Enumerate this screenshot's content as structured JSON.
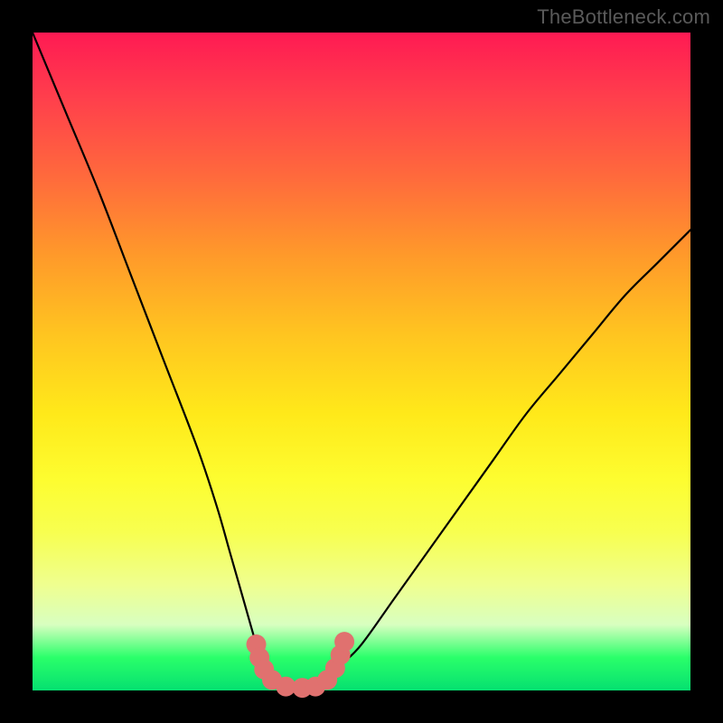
{
  "watermark": "TheBottleneck.com",
  "colors": {
    "background": "#000000",
    "curve_stroke": "#000000",
    "marker_fill": "#e0716f",
    "gradient_top": "#ff1a53",
    "gradient_bottom": "#05e070"
  },
  "chart_data": {
    "type": "line",
    "title": "",
    "xlabel": "",
    "ylabel": "",
    "xlim": [
      0,
      100
    ],
    "ylim": [
      0,
      100
    ],
    "grid": false,
    "series": [
      {
        "name": "bottleneck-curve",
        "x": [
          0,
          5,
          10,
          15,
          20,
          25,
          28,
          30,
          32,
          34,
          35,
          37,
          40,
          43,
          45,
          47,
          50,
          55,
          60,
          65,
          70,
          75,
          80,
          85,
          90,
          95,
          100
        ],
        "y": [
          100,
          88,
          76,
          63,
          50,
          37,
          28,
          21,
          14,
          7,
          4,
          2,
          0,
          0,
          2,
          4,
          7,
          14,
          21,
          28,
          35,
          42,
          48,
          54,
          60,
          65,
          70
        ]
      }
    ],
    "markers": [
      {
        "x": 34.0,
        "y": 7.0
      },
      {
        "x": 34.5,
        "y": 5.0
      },
      {
        "x": 35.2,
        "y": 3.2
      },
      {
        "x": 36.4,
        "y": 1.6
      },
      {
        "x": 38.5,
        "y": 0.6
      },
      {
        "x": 41.0,
        "y": 0.4
      },
      {
        "x": 43.0,
        "y": 0.6
      },
      {
        "x": 44.8,
        "y": 1.6
      },
      {
        "x": 46.0,
        "y": 3.4
      },
      {
        "x": 46.8,
        "y": 5.4
      },
      {
        "x": 47.4,
        "y": 7.4
      }
    ]
  }
}
